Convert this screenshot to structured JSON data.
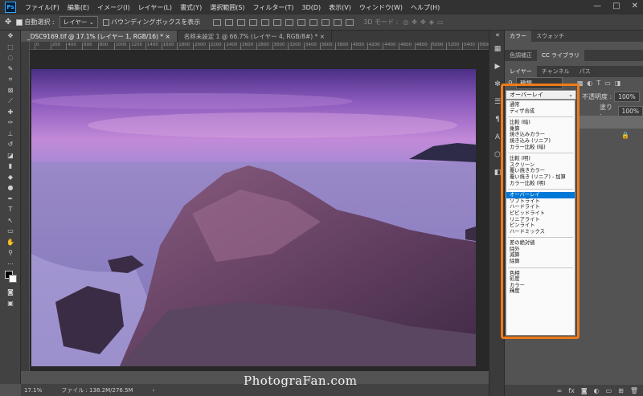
{
  "menubar": {
    "app_icon": "Ps",
    "items": [
      "ファイル(F)",
      "編集(E)",
      "イメージ(I)",
      "レイヤー(L)",
      "書式(Y)",
      "選択範囲(S)",
      "フィルター(T)",
      "3D(D)",
      "表示(V)",
      "ウィンドウ(W)",
      "ヘルプ(H)"
    ],
    "window_controls": [
      "—",
      "□",
      "✕"
    ]
  },
  "options": {
    "auto_select_label": "自動選択 :",
    "layer_select_value": "レイヤー",
    "bounding_box_label": "バウンディングボックスを表示",
    "mode_3d_label": "3D モード :"
  },
  "tabs": [
    {
      "label": "_DSC9169.tif @ 17.1% (レイヤー 1, RGB/16) *",
      "close": "×"
    },
    {
      "label": "名称未設定 1 @ 66.7% (レイヤー 4, RGB/8#) *",
      "close": "×"
    }
  ],
  "ruler_ticks": [
    "0",
    "200",
    "400",
    "600",
    "800",
    "1000",
    "1200",
    "1400",
    "1600",
    "1800",
    "2000",
    "2200",
    "2400",
    "2600",
    "2800",
    "3000",
    "3200",
    "3400",
    "3600",
    "3800",
    "4000",
    "4200",
    "4400",
    "4600",
    "4800",
    "5000",
    "5200",
    "5400",
    "5600"
  ],
  "status": {
    "zoom": "17.1%",
    "file_info": "ファイル : 138.2M/276.5M"
  },
  "panels": {
    "row1_tabs": [
      "カラー",
      "スウォッチ"
    ],
    "row2_tabs": [
      "色調補正",
      "CC ライブラリ"
    ],
    "row3_tabs": [
      "レイヤー",
      "チャンネル",
      "パス"
    ],
    "kind_filter": "種類",
    "opacity_label": "不透明度 :",
    "opacity_value": "100%",
    "fill_label": "塗り :",
    "fill_value": "100%"
  },
  "blend": {
    "selected": "オーバーレイ",
    "groups": [
      [
        "通常",
        "ディザ合成"
      ],
      [
        "比較 (暗)",
        "乗算",
        "焼き込みカラー",
        "焼き込み (リニア)",
        "カラー比較 (暗)"
      ],
      [
        "比較 (明)",
        "スクリーン",
        "覆い焼きカラー",
        "覆い焼き (リニア) - 加算",
        "カラー比較 (明)"
      ],
      [
        "オーバーレイ",
        "ソフトライト",
        "ハードライト",
        "ビビッドライト",
        "リニアライト",
        "ピンライト",
        "ハードミックス"
      ],
      [
        "差の絶対値",
        "除外",
        "減算",
        "除算"
      ],
      [
        "色相",
        "彩度",
        "カラー",
        "輝度"
      ]
    ]
  },
  "watermark": "PhotograFan.com",
  "colors": {
    "highlight": "#f07a17",
    "selection": "#0078d7"
  }
}
